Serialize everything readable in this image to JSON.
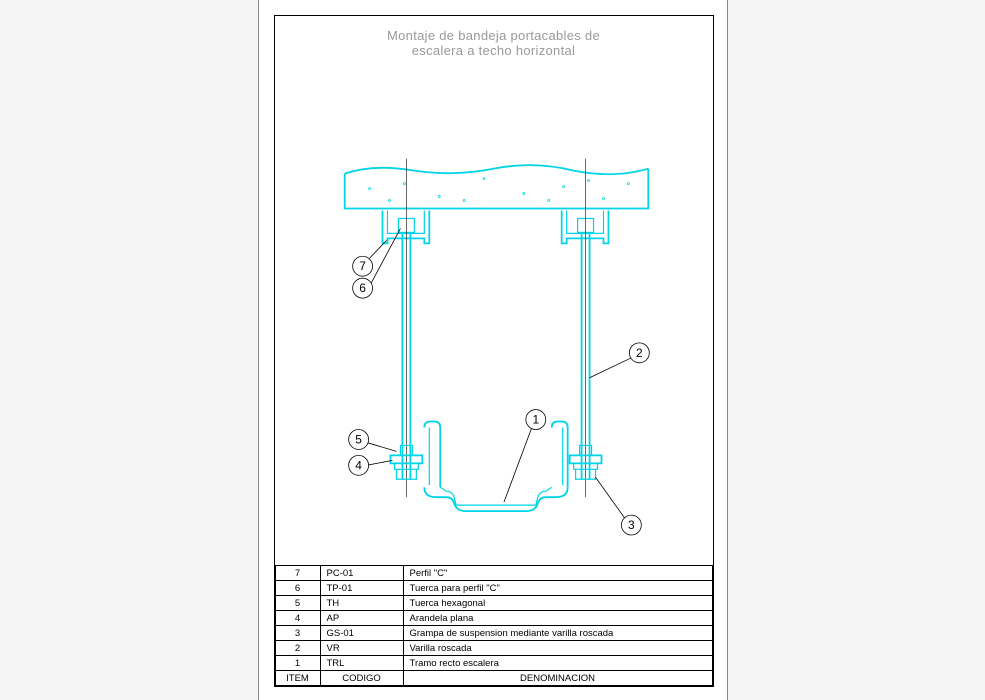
{
  "title": {
    "line1": "Montaje de bandeja portacables de",
    "line2": "escalera a techo horizontal"
  },
  "callouts": {
    "c1": "1",
    "c2": "2",
    "c3": "3",
    "c4": "4",
    "c5": "5",
    "c6": "6",
    "c7": "7"
  },
  "table": {
    "headers": {
      "item": "ITEM",
      "codigo": "CODIGO",
      "denominacion": "DENOMINACION"
    },
    "rows": [
      {
        "item": "7",
        "codigo": "PC-01",
        "denominacion": "Perfil \"C\""
      },
      {
        "item": "6",
        "codigo": "TP-01",
        "denominacion": "Tuerca para perfil \"C\""
      },
      {
        "item": "5",
        "codigo": "TH",
        "denominacion": "Tuerca hexagonal"
      },
      {
        "item": "4",
        "codigo": "AP",
        "denominacion": "Arandela plana"
      },
      {
        "item": "3",
        "codigo": "GS-01",
        "denominacion": "Grampa de suspension mediante varilla roscada"
      },
      {
        "item": "2",
        "codigo": "VR",
        "denominacion": "Varilla roscada"
      },
      {
        "item": "1",
        "codigo": "TRL",
        "denominacion": "Tramo recto escalera"
      }
    ]
  }
}
